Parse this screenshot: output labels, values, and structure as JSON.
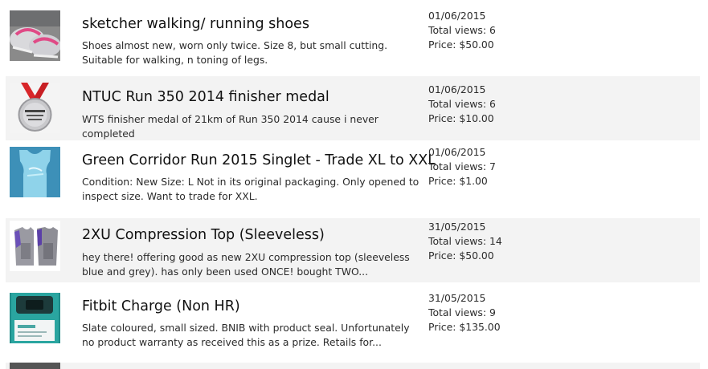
{
  "listings": [
    {
      "title": "sketcher walking/ running shoes",
      "description": "Shoes almost new, worn only twice. Size 8, but small cutting. Suitable for walking, n toning of legs.",
      "date": "01/06/2015",
      "views": "Total views: 6",
      "price": "Price: $50.00",
      "thumbnail_icon": "shoes-photo"
    },
    {
      "title": "NTUC Run 350 2014 finisher medal",
      "description": "WTS finisher medal of 21km of Run 350 2014 cause i never completed",
      "date": "01/06/2015",
      "views": "Total views: 6",
      "price": "Price: $10.00",
      "thumbnail_icon": "medal-photo"
    },
    {
      "title": "Green Corridor Run 2015 Singlet - Trade XL to XXL",
      "description": "Condition: New Size: L Not in its original packaging. Only opened to inspect size. Want to trade for XXL.",
      "date": "01/06/2015",
      "views": "Total views: 7",
      "price": "Price: $1.00",
      "thumbnail_icon": "singlet-photo"
    },
    {
      "title": "2XU Compression Top (Sleeveless)",
      "description": "hey there! offering good as new 2XU compression top (sleeveless blue and grey). has only been used ONCE! bought TWO...",
      "date": "31/05/2015",
      "views": "Total views: 14",
      "price": "Price: $50.00",
      "thumbnail_icon": "compression-top-photo"
    },
    {
      "title": "Fitbit Charge (Non HR)",
      "description": "Slate coloured, small sized. BNIB with product seal. Unfortunately no product warranty as received this as a prize. Retails for...",
      "date": "31/05/2015",
      "views": "Total views: 9",
      "price": "Price: $135.00",
      "thumbnail_icon": "fitbit-box-photo"
    }
  ],
  "colors": {
    "alt_row_background": "#f3f3f3",
    "text": "#2b2b2b"
  }
}
